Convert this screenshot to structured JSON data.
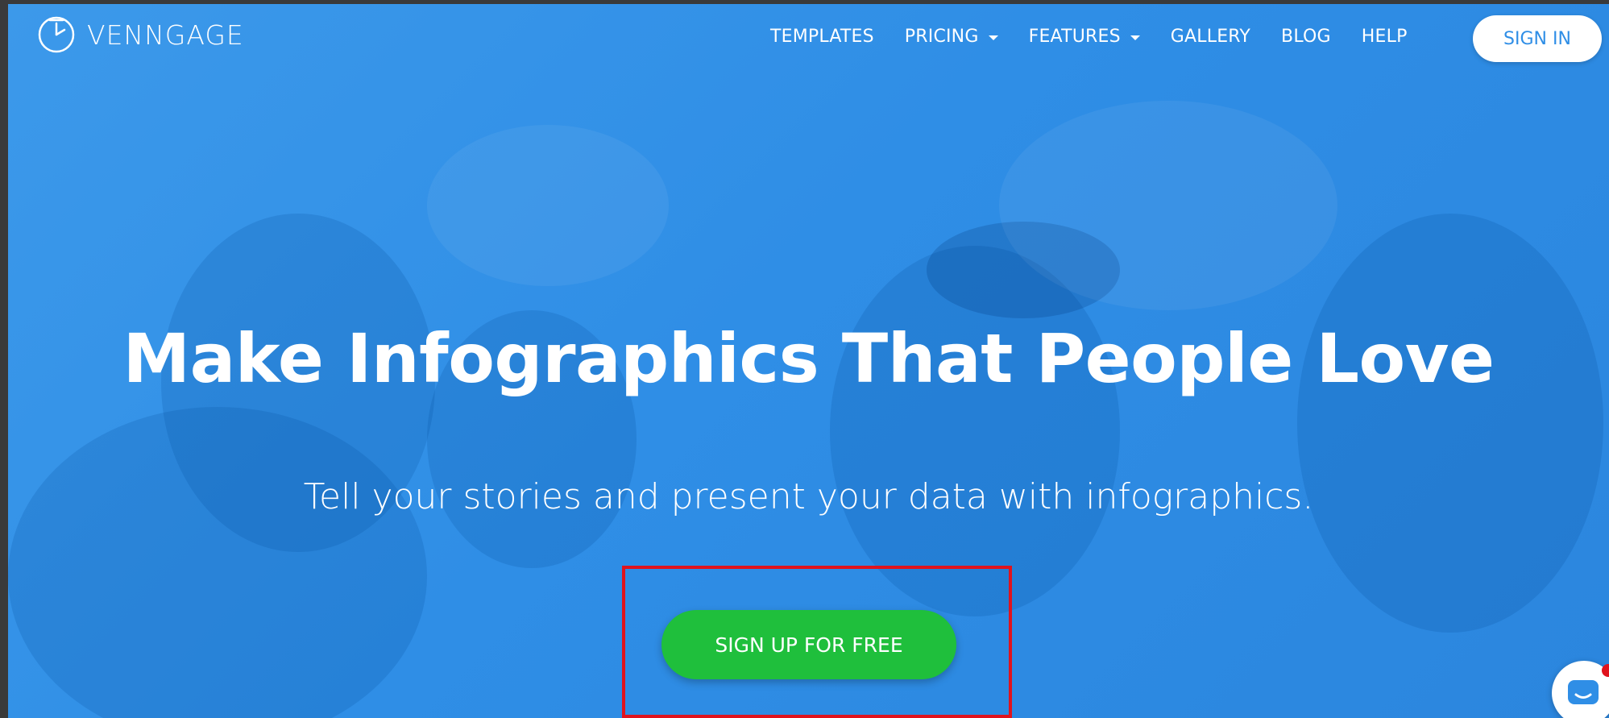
{
  "brand": {
    "name": "VENNGAGE",
    "icon": "clock-pie-logo-icon"
  },
  "nav": {
    "items": [
      {
        "label": "TEMPLATES",
        "has_dropdown": false
      },
      {
        "label": "PRICING",
        "has_dropdown": true
      },
      {
        "label": "FEATURES",
        "has_dropdown": true
      },
      {
        "label": "GALLERY",
        "has_dropdown": false
      },
      {
        "label": "BLOG",
        "has_dropdown": false
      },
      {
        "label": "HELP",
        "has_dropdown": false
      }
    ],
    "signin_label": "SIGN IN"
  },
  "hero": {
    "headline": "Make Infographics That People Love",
    "subheadline": "Tell your stories and present your data with infographics.",
    "cta_label": "SIGN UP FOR FREE"
  },
  "chat": {
    "icon": "chat-bubble-icon"
  },
  "colors": {
    "hero_background": "#2f8ee6",
    "cta_green": "#1fbf3c",
    "highlight_red": "#e0131d",
    "signin_text": "#2f8ee6"
  }
}
